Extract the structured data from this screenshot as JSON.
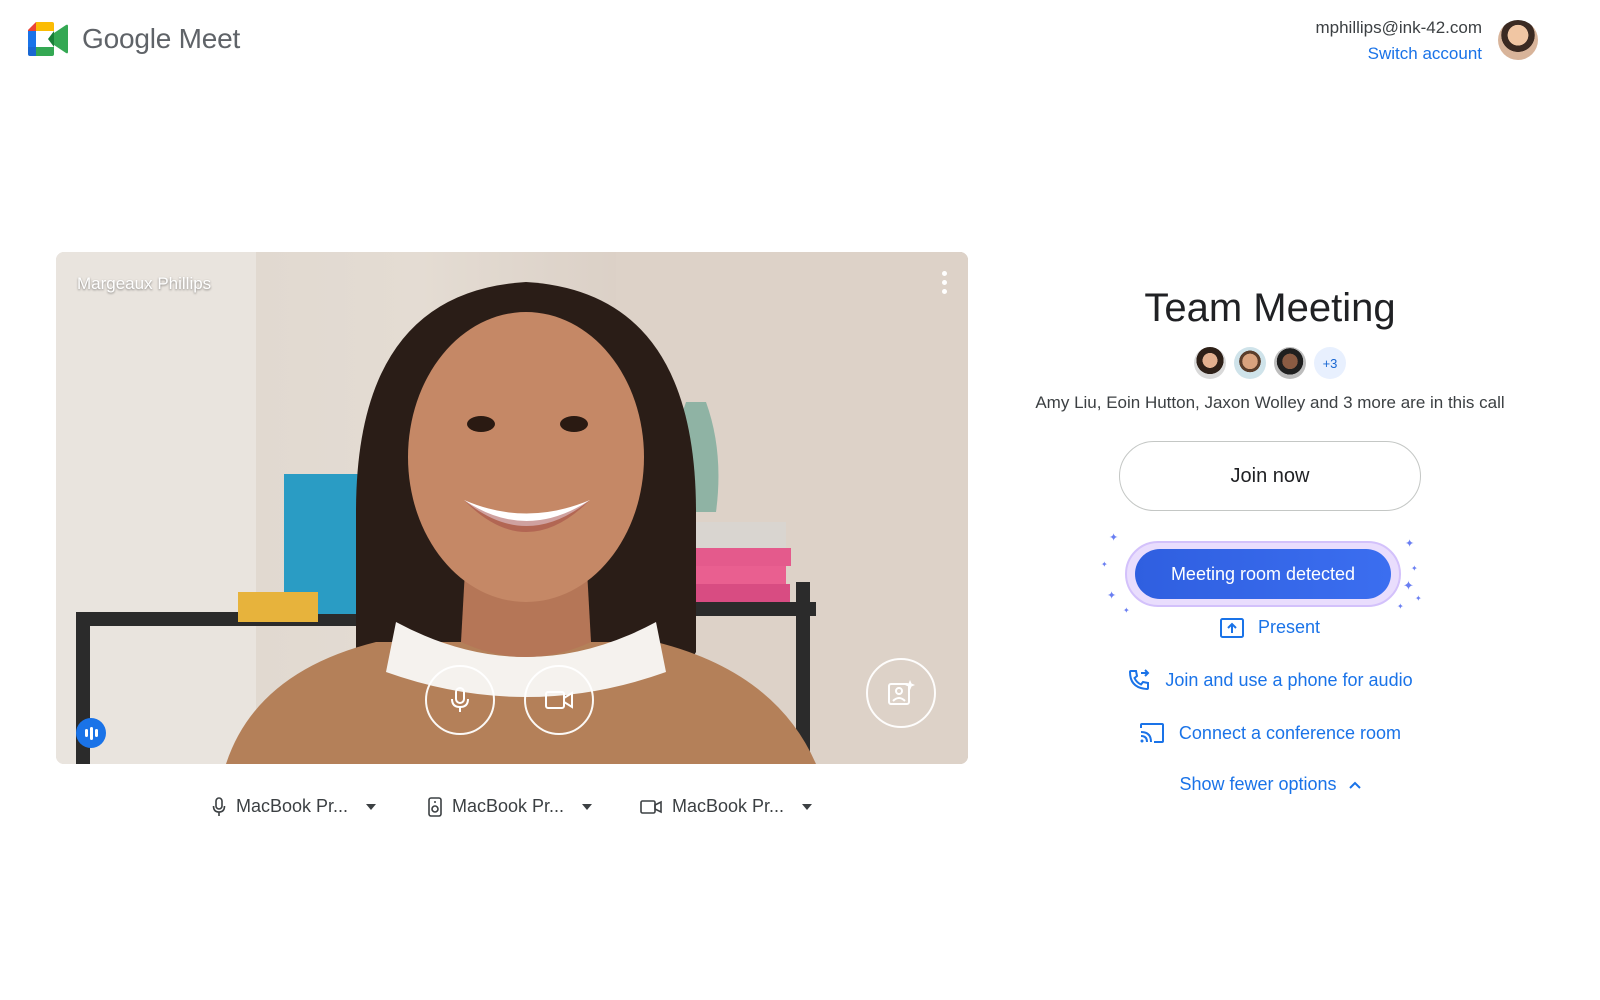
{
  "app": {
    "logo_text": "Google Meet",
    "icon": "google-meet-logo-icon"
  },
  "account": {
    "email": "mphillips@ink-42.com",
    "switch_label": "Switch account"
  },
  "preview": {
    "name": "Margeaux Phillips",
    "controls": {
      "mic_icon": "microphone-icon",
      "camera_icon": "video-camera-icon",
      "effects_icon": "visual-effects-icon",
      "menu_icon": "more-vert-icon"
    }
  },
  "devices": [
    {
      "label": "MacBook Pr...",
      "icon": "microphone-icon"
    },
    {
      "label": "MacBook Pr...",
      "icon": "speaker-icon"
    },
    {
      "label": "MacBook Pr...",
      "icon": "video-camera-icon"
    }
  ],
  "meeting": {
    "title": "Team Meeting",
    "more_count": "+3",
    "in_call_text": "Amy Liu, Eoin Hutton, Jaxon Wolley and 3 more are in this call",
    "join_label": "Join now",
    "detected_label": "Meeting room detected",
    "present_label": "Present",
    "phone_label": "Join and use a phone for audio",
    "conference_label": "Connect a conference room",
    "fewer_label": "Show fewer options"
  },
  "colors": {
    "accent": "#1a73e8",
    "detected_button": "#3567e8",
    "detected_glow": "#e9ddfd"
  }
}
